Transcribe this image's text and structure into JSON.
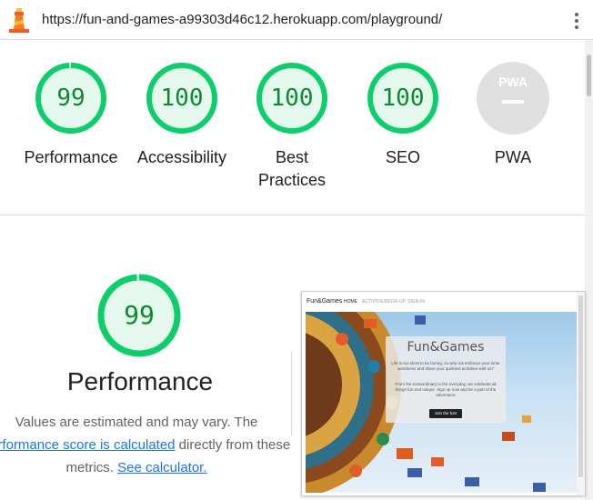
{
  "address_bar": {
    "url": "https://fun-and-games-a99303d46c12.herokuapp.com/playground/",
    "icon": "lighthouse-icon",
    "menu_icon": "more-vert-icon"
  },
  "summary_scores": [
    {
      "label": "Performance",
      "score": "99"
    },
    {
      "label": "Accessibility",
      "score": "100"
    },
    {
      "label_line1": "Best",
      "label_line2": "Practices",
      "score": "100"
    },
    {
      "label": "SEO",
      "score": "100"
    },
    {
      "label": "PWA",
      "badge": "PWA"
    }
  ],
  "performance_section": {
    "score": "99",
    "title": "Performance",
    "desc_line1": "Values are estimated and may vary. The",
    "desc_link1": "performance score is calculated",
    "desc_line2_tail": " directly from these",
    "desc_line3_head": "metrics. ",
    "desc_link2": "See calculator."
  },
  "screenshot": {
    "brand": "Fun&Games",
    "nav": [
      "HOME",
      "ACTIVITIES",
      "SIGN-UP",
      "SIGN-IN"
    ],
    "hero_title": "Fun&Games",
    "hero_text1": "Life is too short to be boring, so why not embrace your inner weirdness and share your quirkiest activities with us?",
    "hero_text2": "From the extraordinary to the everyday, we celebrate all things fun and unique. Sign up now and be a part of the adventure!",
    "hero_button": "Join the fun!"
  },
  "colors": {
    "pass_green": "#0cce6b",
    "pass_fill": "#e5f8ee",
    "score_text": "#0d8a2d",
    "link": "#1a73e8",
    "pwa_gray": "#e0e0e0"
  }
}
